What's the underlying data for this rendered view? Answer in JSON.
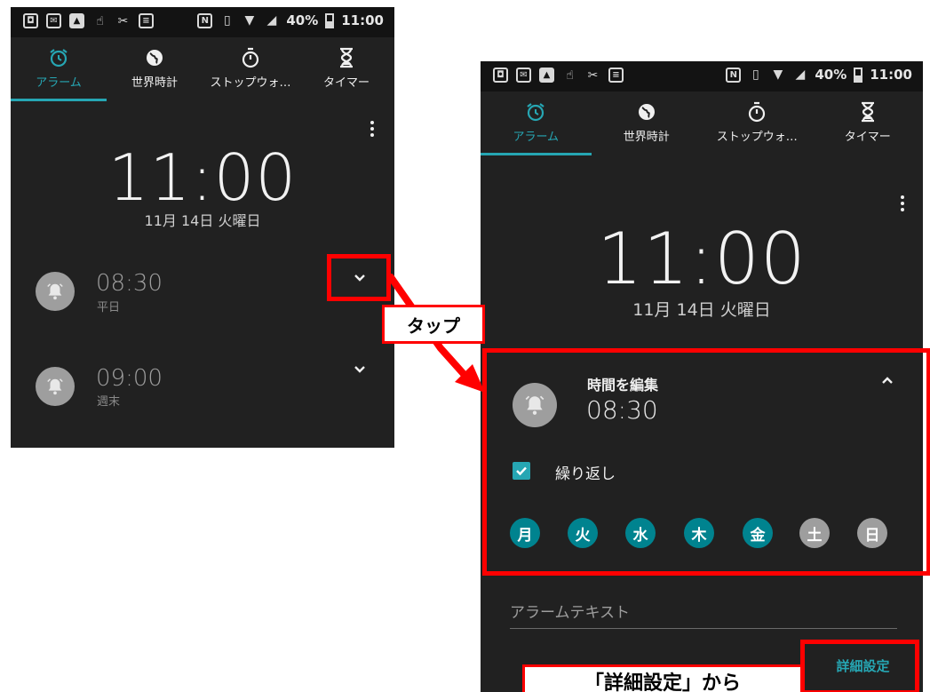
{
  "status": {
    "battery": "40%",
    "time": "11:00"
  },
  "tabs": [
    {
      "label": "アラーム",
      "icon": "alarm-clock-icon"
    },
    {
      "label": "世界時計",
      "icon": "globe-icon"
    },
    {
      "label": "ストップウォ…",
      "icon": "stopwatch-icon"
    },
    {
      "label": "タイマー",
      "icon": "hourglass-icon"
    }
  ],
  "clock": {
    "time": "11:00",
    "date": "11月 14日 火曜日"
  },
  "alarms": [
    {
      "time": "08:30",
      "label": "平日"
    },
    {
      "time": "09:00",
      "label": "週末"
    }
  ],
  "expanded": {
    "edit_label": "時間を編集",
    "time": "08:30",
    "repeat_label": "繰り返し",
    "days": [
      {
        "label": "月",
        "on": true
      },
      {
        "label": "火",
        "on": true
      },
      {
        "label": "水",
        "on": true
      },
      {
        "label": "木",
        "on": true
      },
      {
        "label": "金",
        "on": true
      },
      {
        "label": "土",
        "on": false
      },
      {
        "label": "日",
        "on": false
      }
    ],
    "alarm_text_placeholder": "アラームテキスト",
    "detail_button": "詳細設定"
  },
  "annotations": {
    "tap": "タップ",
    "from_detail": "「詳細設定」から"
  },
  "colors": {
    "accent": "#26a6b3",
    "highlight": "#ff0000",
    "day_on": "#00838f",
    "day_off": "#9e9e9e"
  }
}
